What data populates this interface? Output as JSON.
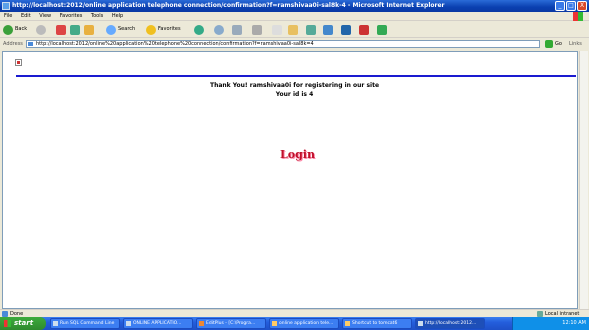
{
  "window": {
    "title": "http://localhost:2012/online application telephone connection/confirmation?f=ramshivaa0i-sal8k-4 - Microsoft Internet Explorer",
    "minimize": "_",
    "maximize": "□",
    "close": "X"
  },
  "menu": [
    "File",
    "Edit",
    "View",
    "Favorites",
    "Tools",
    "Help"
  ],
  "toolbar": {
    "back": "Back",
    "search": "Search",
    "favorites": "Favorites"
  },
  "address": {
    "label": "Address",
    "url": "http://localhost:2012/online%20application%20telephone%20connection/confirmation?f=ramshivaa0i-sal8k=4",
    "go": "Go",
    "links": "Links"
  },
  "page": {
    "thanks": "Thank You! ramshivaa0i for registering in our site",
    "user_id": "Your id is 4",
    "login_link": "Login",
    "accent_color": "#1a1ad0"
  },
  "status": {
    "text": "Done",
    "zone": "Local intranet"
  },
  "taskbar": {
    "start": "start",
    "tasks": [
      "Run SQL Command Line",
      "ONLINE APPLICATIO...",
      "EditPlus - [C:\\Progra...",
      "online application tele...",
      "Shortcut to tomcat6",
      "http://localhost:2012..."
    ],
    "clock": "12:10 AM"
  }
}
